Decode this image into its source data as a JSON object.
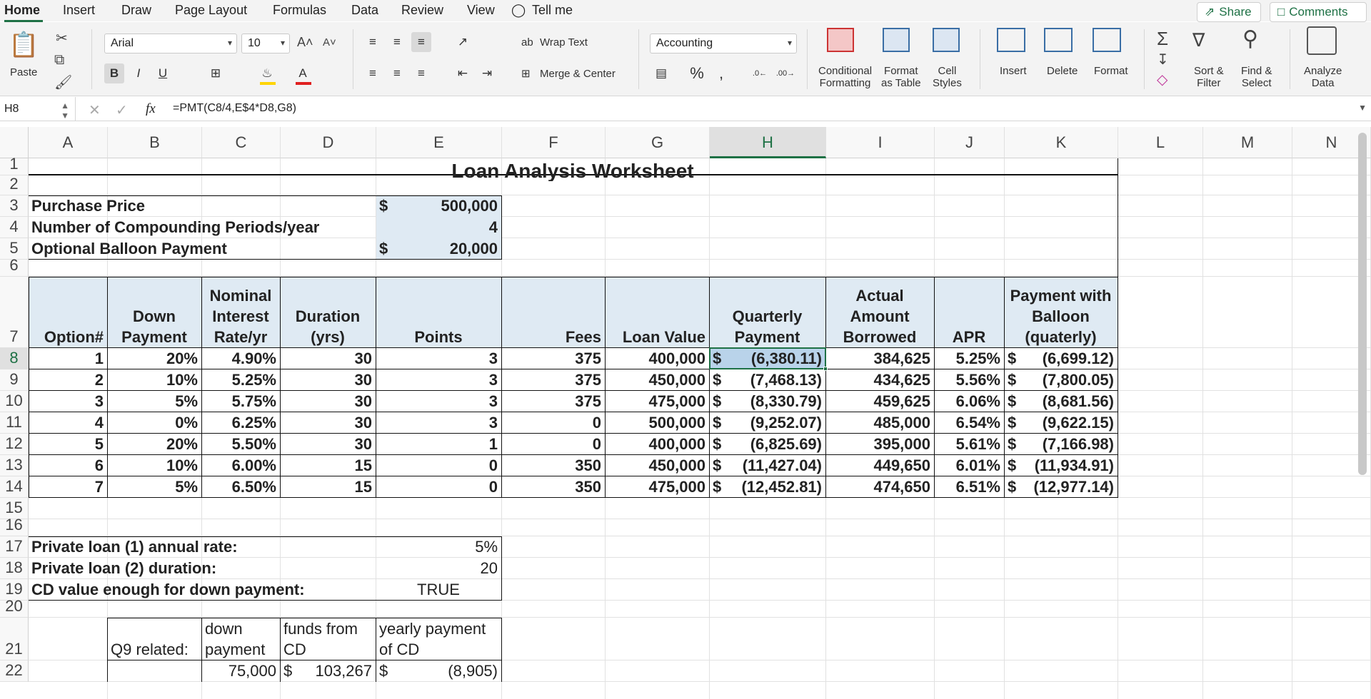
{
  "tabs": {
    "items": [
      "Home",
      "Insert",
      "Draw",
      "Page Layout",
      "Formulas",
      "Data",
      "Review",
      "View"
    ],
    "tell_me": "Tell me",
    "share": "Share",
    "comments": "Comments"
  },
  "ribbon": {
    "paste": "Paste",
    "font_name": "Arial",
    "font_size": "10",
    "wrap_text": "Wrap Text",
    "merge_center": "Merge & Center",
    "number_format": "Accounting",
    "conditional_formatting": [
      "Conditional",
      "Formatting"
    ],
    "format_as_table": [
      "Format",
      "as Table"
    ],
    "cell_styles": [
      "Cell",
      "Styles"
    ],
    "insert": "Insert",
    "delete": "Delete",
    "format": "Format",
    "sort_filter": [
      "Sort &",
      "Filter"
    ],
    "find_select": [
      "Find &",
      "Select"
    ],
    "analyze_data": [
      "Analyze",
      "Data"
    ],
    "colors": {
      "highlight": "#ffd400",
      "font": "#e02020"
    }
  },
  "formula_bar": {
    "name_box": "H8",
    "fx": "fx",
    "formula": "=PMT(C8/4,E$4*D8,G8)"
  },
  "grid": {
    "columns": [
      "A",
      "B",
      "C",
      "D",
      "E",
      "F",
      "G",
      "H",
      "I",
      "J",
      "K",
      "L",
      "M",
      "N"
    ],
    "selected_column": "H",
    "rows": [
      "1",
      "2",
      "3",
      "4",
      "5",
      "6",
      "7",
      "8",
      "9",
      "10",
      "11",
      "12",
      "13",
      "14",
      "15",
      "16",
      "17",
      "18",
      "19",
      "20",
      "21",
      "22"
    ],
    "selected_row": "8"
  },
  "sheet": {
    "title": "Loan Analysis Worksheet",
    "inputs": [
      {
        "label": "Purchase Price",
        "currency": "$",
        "value": "500,000"
      },
      {
        "label": "Number of Compounding Periods/year",
        "currency": "",
        "value": "4"
      },
      {
        "label": "Optional Balloon Payment",
        "currency": "$",
        "value": "20,000"
      }
    ],
    "headers": {
      "option": [
        "Option#"
      ],
      "down": [
        "Down",
        "Payment"
      ],
      "rate": [
        "Nominal",
        "Interest",
        "Rate/yr"
      ],
      "duration": [
        "Duration",
        "(yrs)"
      ],
      "points": [
        "Points"
      ],
      "fees": [
        "Fees"
      ],
      "loan_value": [
        "Loan Value"
      ],
      "quarterly": [
        "Quarterly",
        "Payment"
      ],
      "actual": [
        "Actual",
        "Amount",
        "Borrowed"
      ],
      "apr": [
        "APR"
      ],
      "balloon": [
        "Payment with",
        "Balloon",
        "(quaterly)"
      ]
    },
    "table": [
      {
        "option": "1",
        "down": "20%",
        "rate": "4.90%",
        "duration": "30",
        "points": "3",
        "fees": "375",
        "loan": "400,000",
        "qp_cur": "$",
        "qp": "(6,380.11)",
        "actual": "384,625",
        "apr": "5.25%",
        "bp_cur": "$",
        "bp": "(6,699.12)"
      },
      {
        "option": "2",
        "down": "10%",
        "rate": "5.25%",
        "duration": "30",
        "points": "3",
        "fees": "375",
        "loan": "450,000",
        "qp_cur": "$",
        "qp": "(7,468.13)",
        "actual": "434,625",
        "apr": "5.56%",
        "bp_cur": "$",
        "bp": "(7,800.05)"
      },
      {
        "option": "3",
        "down": "5%",
        "rate": "5.75%",
        "duration": "30",
        "points": "3",
        "fees": "375",
        "loan": "475,000",
        "qp_cur": "$",
        "qp": "(8,330.79)",
        "actual": "459,625",
        "apr": "6.06%",
        "bp_cur": "$",
        "bp": "(8,681.56)"
      },
      {
        "option": "4",
        "down": "0%",
        "rate": "6.25%",
        "duration": "30",
        "points": "3",
        "fees": "0",
        "loan": "500,000",
        "qp_cur": "$",
        "qp": "(9,252.07)",
        "actual": "485,000",
        "apr": "6.54%",
        "bp_cur": "$",
        "bp": "(9,622.15)"
      },
      {
        "option": "5",
        "down": "20%",
        "rate": "5.50%",
        "duration": "30",
        "points": "1",
        "fees": "0",
        "loan": "400,000",
        "qp_cur": "$",
        "qp": "(6,825.69)",
        "actual": "395,000",
        "apr": "5.61%",
        "bp_cur": "$",
        "bp": "(7,166.98)"
      },
      {
        "option": "6",
        "down": "10%",
        "rate": "6.00%",
        "duration": "15",
        "points": "0",
        "fees": "350",
        "loan": "450,000",
        "qp_cur": "$",
        "qp": "(11,427.04)",
        "actual": "449,650",
        "apr": "6.01%",
        "bp_cur": "$",
        "bp": "(11,934.91)"
      },
      {
        "option": "7",
        "down": "5%",
        "rate": "6.50%",
        "duration": "15",
        "points": "0",
        "fees": "350",
        "loan": "475,000",
        "qp_cur": "$",
        "qp": "(12,452.81)",
        "actual": "474,650",
        "apr": "6.51%",
        "bp_cur": "$",
        "bp": "(12,977.14)"
      }
    ],
    "private": [
      {
        "label": "Private loan (1) annual rate:",
        "value": "5%"
      },
      {
        "label": "Private loan (2) duration:",
        "value": "20"
      },
      {
        "label": "CD value enough for down payment:",
        "value": "TRUE"
      }
    ],
    "q9": {
      "label": "Q9 related:",
      "down_header": [
        "down",
        "payment"
      ],
      "funds_header": [
        "funds from",
        "CD"
      ],
      "yearly_header": [
        "yearly payment",
        "of CD"
      ],
      "down_value": "75,000",
      "funds_cur": "$",
      "funds_value": "103,267",
      "yearly_cur": "$",
      "yearly_value": "(8,905)"
    }
  }
}
